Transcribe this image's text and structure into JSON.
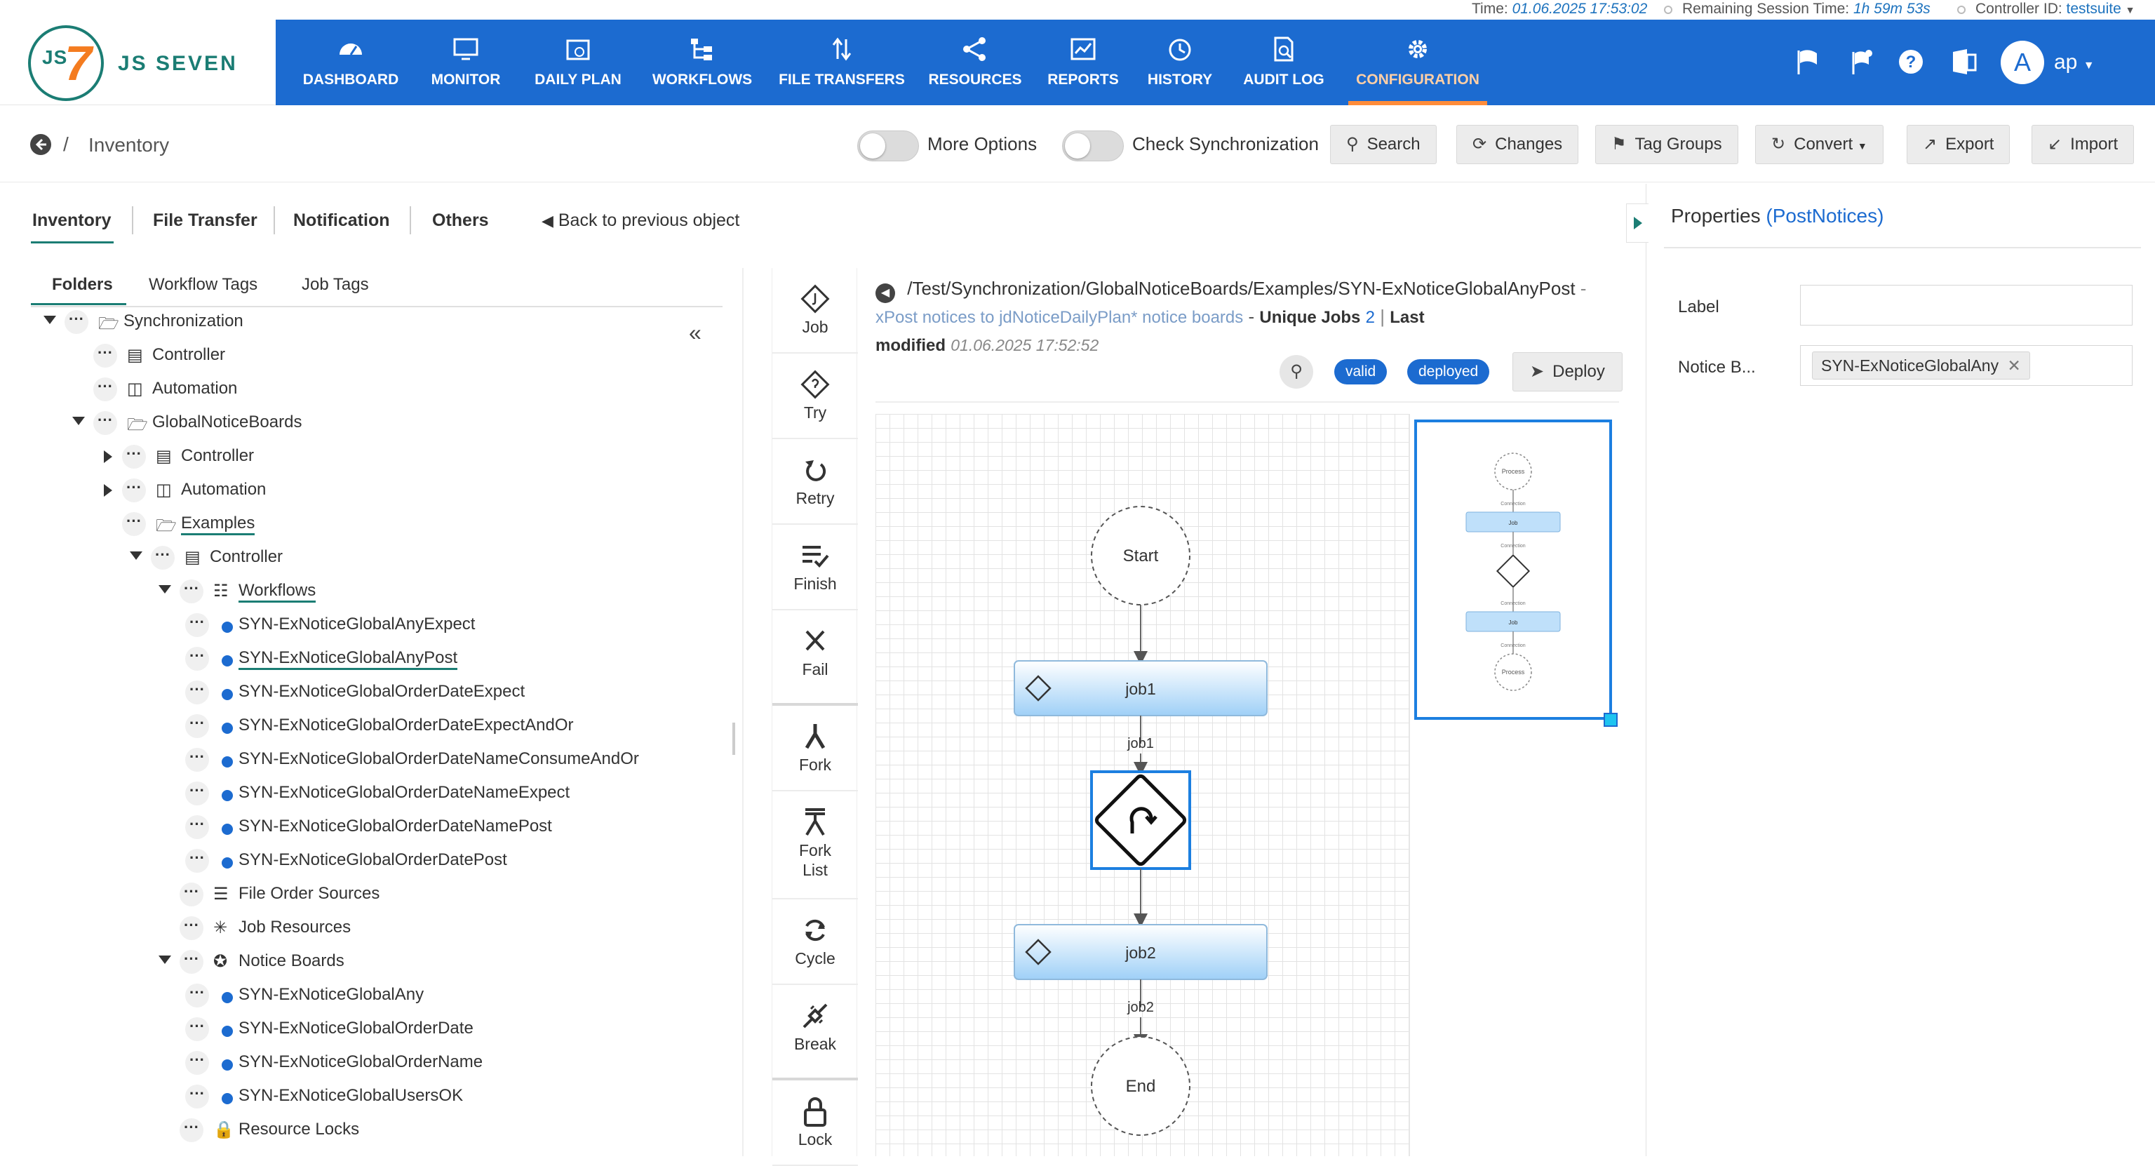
{
  "status_bar": {
    "time_label": "Time:",
    "time_value": "01.06.2025 17:53:02",
    "session_label": "Remaining Session Time:",
    "session_value": "1h 59m 53s",
    "controller_label": "Controller ID:",
    "controller_value": "testsuite"
  },
  "brand": {
    "mark_js": "JS",
    "mark_seven": "7",
    "name": "JS SEVEN"
  },
  "nav": {
    "items": [
      {
        "label": "DASHBOARD",
        "icon": "dashboard-icon"
      },
      {
        "label": "MONITOR",
        "icon": "monitor-icon"
      },
      {
        "label": "DAILY PLAN",
        "icon": "calendar-icon"
      },
      {
        "label": "WORKFLOWS",
        "icon": "workflow-icon"
      },
      {
        "label": "FILE TRANSFERS",
        "icon": "transfer-icon"
      },
      {
        "label": "RESOURCES",
        "icon": "share-icon"
      },
      {
        "label": "REPORTS",
        "icon": "chart-icon"
      },
      {
        "label": "HISTORY",
        "icon": "clock-icon"
      },
      {
        "label": "AUDIT LOG",
        "icon": "audit-icon"
      },
      {
        "label": "CONFIGURATION",
        "icon": "gear-icon",
        "active": true
      }
    ],
    "user_initial": "A",
    "user_name": "ap"
  },
  "toolbar": {
    "breadcrumb_sep": "/",
    "breadcrumb": "Inventory",
    "more_options": "More Options",
    "check_sync": "Check Synchronization",
    "search": "Search",
    "changes": "Changes",
    "tag_groups": "Tag Groups",
    "convert": "Convert",
    "export": "Export",
    "import": "Import"
  },
  "tabs": {
    "main": [
      "Inventory",
      "File Transfer",
      "Notification",
      "Others"
    ],
    "back_link": "Back to previous object",
    "sub": [
      "Folders",
      "Workflow Tags",
      "Job Tags"
    ]
  },
  "tree": [
    {
      "level": 0,
      "caret": "down",
      "icon": "folder",
      "label": "Synchronization"
    },
    {
      "level": 1,
      "caret": "",
      "icon": "doc",
      "label": "Controller"
    },
    {
      "level": 1,
      "caret": "",
      "icon": "cal",
      "label": "Automation"
    },
    {
      "level": 1,
      "caret": "down",
      "icon": "folder",
      "label": "GlobalNoticeBoards"
    },
    {
      "level": 2,
      "caret": "right",
      "icon": "doc",
      "label": "Controller"
    },
    {
      "level": 2,
      "caret": "right",
      "icon": "cal",
      "label": "Automation"
    },
    {
      "level": 2,
      "caret": "",
      "icon": "folder",
      "label": "Examples",
      "underline": true
    },
    {
      "level": 3,
      "caret": "down",
      "icon": "doc",
      "label": "Controller"
    },
    {
      "level": 4,
      "caret": "down",
      "icon": "workflow",
      "label": "Workflows",
      "underline": true
    },
    {
      "level": 5,
      "caret": "",
      "icon": "bullet",
      "label": "SYN-ExNoticeGlobalAnyExpect"
    },
    {
      "level": 5,
      "caret": "",
      "icon": "bullet",
      "label": "SYN-ExNoticeGlobalAnyPost",
      "underline": true
    },
    {
      "level": 5,
      "caret": "",
      "icon": "bullet",
      "label": "SYN-ExNoticeGlobalOrderDateExpect"
    },
    {
      "level": 5,
      "caret": "",
      "icon": "bullet",
      "label": "SYN-ExNoticeGlobalOrderDateExpectAndOr"
    },
    {
      "level": 5,
      "caret": "",
      "icon": "bullet",
      "label": "SYN-ExNoticeGlobalOrderDateNameConsumeAndOr"
    },
    {
      "level": 5,
      "caret": "",
      "icon": "bullet",
      "label": "SYN-ExNoticeGlobalOrderDateNameExpect"
    },
    {
      "level": 5,
      "caret": "",
      "icon": "bullet",
      "label": "SYN-ExNoticeGlobalOrderDateNamePost"
    },
    {
      "level": 5,
      "caret": "",
      "icon": "bullet",
      "label": "SYN-ExNoticeGlobalOrderDatePost"
    },
    {
      "level": 4,
      "caret": "",
      "icon": "list",
      "label": "File Order Sources"
    },
    {
      "level": 4,
      "caret": "",
      "icon": "share",
      "label": "Job Resources"
    },
    {
      "level": 4,
      "caret": "down",
      "icon": "pin",
      "label": "Notice Boards"
    },
    {
      "level": 5,
      "caret": "",
      "icon": "bullet",
      "label": "SYN-ExNoticeGlobalAny"
    },
    {
      "level": 5,
      "caret": "",
      "icon": "bullet",
      "label": "SYN-ExNoticeGlobalOrderDate"
    },
    {
      "level": 5,
      "caret": "",
      "icon": "bullet",
      "label": "SYN-ExNoticeGlobalOrderName"
    },
    {
      "level": 5,
      "caret": "",
      "icon": "bullet",
      "label": "SYN-ExNoticeGlobalUsersOK"
    },
    {
      "level": 4,
      "caret": "",
      "icon": "lock",
      "label": "Resource Locks"
    }
  ],
  "palette": [
    "Job",
    "Try",
    "Retry",
    "Finish",
    "Fail",
    "Fork",
    "Fork List",
    "Cycle",
    "Break",
    "Lock"
  ],
  "workflow": {
    "path": "/Test/Synchronization/GlobalNoticeBoards/Examples/SYN-ExNoticeGlobalAnyPost",
    "dash": " - ",
    "title": "xPost notices to jdNoticeDailyPlan* notice boards",
    "unique_jobs_label": "Unique Jobs",
    "unique_jobs_value": "2",
    "last_modified_label_1": "Last",
    "last_modified_label_2": "modified",
    "last_modified_value": "01.06.2025 17:52:52",
    "badge_valid": "valid",
    "badge_deployed": "deployed",
    "deploy": "Deploy",
    "nodes": {
      "start": "Start",
      "job1": "job1",
      "edge1": "job1",
      "job2": "job2",
      "edge2": "job2",
      "end": "End"
    },
    "outline_labels": {
      "process": "Process",
      "connection": "Connection",
      "job": "Job"
    }
  },
  "properties": {
    "title": "Properties",
    "type": "(PostNotices)",
    "label_field": "Label",
    "label_value": "",
    "notice_field": "Notice B...",
    "notice_chip": "SYN-ExNoticeGlobalAny"
  },
  "colors": {
    "header_blue": "#1c6bd0",
    "accent_teal": "#1b7d74",
    "active_orange": "#ff8c3a",
    "selection_blue": "#1c7fe0"
  }
}
